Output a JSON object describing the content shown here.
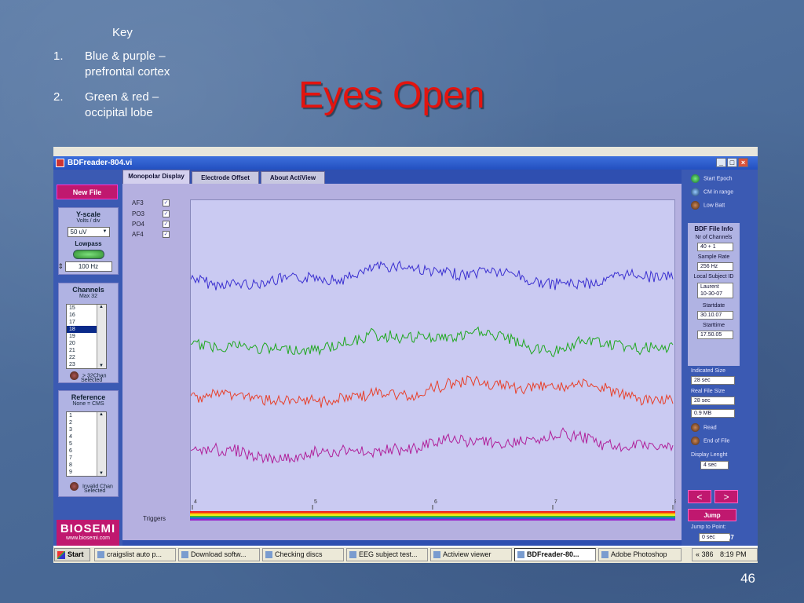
{
  "slide": {
    "title": "Eyes Open",
    "page_number": "46",
    "key": {
      "title": "Key",
      "items": [
        {
          "num": "1.",
          "line1": "Blue & purple –",
          "line2": "prefrontal cortex"
        },
        {
          "num": "2.",
          "line1": "Green & red –",
          "line2": "occipital lobe"
        }
      ]
    }
  },
  "app": {
    "window_title": "BDFreader-804.vi",
    "new_file": "New File",
    "yscale": {
      "label": "Y-scale",
      "sub": "Volts / div",
      "value": "50 uV"
    },
    "lowpass": {
      "label": "Lowpass",
      "value": "100 Hz"
    },
    "channels": {
      "label": "Channels",
      "sub": "Max 32",
      "items": [
        "15",
        "16",
        "17",
        "18",
        "19",
        "20",
        "21",
        "22",
        "23"
      ],
      "selected": "18",
      "led_label1": "> 32Chan",
      "led_label2": "Selected"
    },
    "reference": {
      "label": "Reference",
      "sub": "None = CMS",
      "items": [
        "1",
        "2",
        "3",
        "4",
        "5",
        "6",
        "7",
        "8",
        "9"
      ],
      "led_label1": "Invalid Chan",
      "led_label2": "Selected"
    },
    "logo": {
      "main": "BIOSEMI",
      "url": "www.biosemi.com"
    },
    "tabs": [
      "Monopolar Display",
      "Electrode Offset",
      "About ActiView"
    ],
    "channel_labels": [
      "AF3",
      "PO3",
      "PO4",
      "AF4"
    ],
    "triggers_label": "Triggers",
    "x_ticks": [
      "4",
      "5",
      "6",
      "7",
      "8"
    ],
    "trace_colors": [
      "#3a2fd0",
      "#1fa81f",
      "#e8402a",
      "#b0209a"
    ],
    "status": {
      "start_epoch": "Start Epoch",
      "cm_in_range": "CM in range",
      "low_batt": "Low Batt"
    },
    "file_info": {
      "title": "BDF File Info",
      "nr_channels_label": "Nr of Channels",
      "nr_channels": "40 + 1",
      "sample_rate_label": "Sample Rate",
      "sample_rate": "256 Hz",
      "subject_label": "Local Subject ID",
      "subject_line1": "Laurent",
      "subject_line2": "10-30-07",
      "startdate_label": "Startdate",
      "startdate": "30.10.07",
      "starttime_label": "Starttime",
      "starttime": "17.50.05"
    },
    "indicated_size_label": "Indicated Size",
    "indicated_size": "28        sec",
    "real_size_label": "Real File Size",
    "real_size_sec": "28        sec",
    "real_size_mb": "0.9       MB",
    "read_label": "Read",
    "eof_label": "End of File",
    "display_length_label": "Display Lenght",
    "display_length": "4  sec",
    "prev_label": "<",
    "next_label": ">",
    "jump_label": "Jump",
    "jump_point_label": "Jump to Point:",
    "jump_point_value": "0   sec",
    "year": "2007"
  },
  "taskbar": {
    "start": "Start",
    "items": [
      "craigslist auto p...",
      "Download softw...",
      "Checking discs",
      "EEG subject test...",
      "Actiview viewer",
      "BDFreader-80...",
      "Adobe Photoshop"
    ],
    "active_index": 5,
    "tray_text": "« 386",
    "clock": "8:19 PM"
  }
}
